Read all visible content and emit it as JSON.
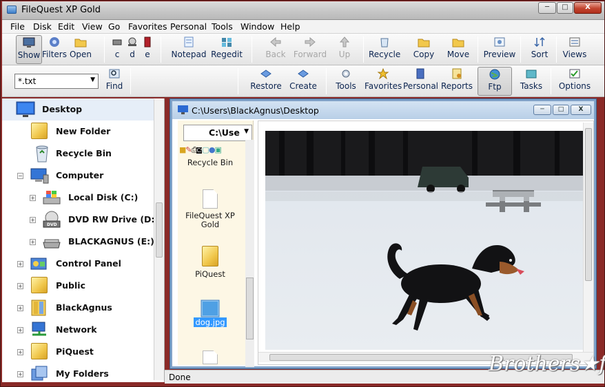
{
  "window": {
    "title": "FileQuest XP Gold"
  },
  "menu": [
    "File",
    "Disk",
    "Edit",
    "View",
    "Go",
    "Favorites",
    "Personal",
    "Tools",
    "Window",
    "Help"
  ],
  "toolbar1": {
    "show": "Show",
    "filters": "Filters",
    "open": "Open",
    "c": "c",
    "d": "d",
    "e": "e",
    "notepad": "Notepad",
    "regedit": "Regedit",
    "back": "Back",
    "forward": "Forward",
    "up": "Up",
    "recycle": "Recycle",
    "copy": "Copy",
    "move": "Move",
    "preview": "Preview",
    "sort": "Sort",
    "views": "Views"
  },
  "toolbar2": {
    "filter_value": "*.txt",
    "find": "Find",
    "restore": "Restore",
    "create": "Create",
    "tools": "Tools",
    "favorites": "Favorites",
    "personal": "Personal",
    "reports": "Reports",
    "ftp": "Ftp",
    "tasks": "Tasks",
    "options": "Options"
  },
  "tree": [
    {
      "label": "Desktop",
      "icon": "desktop-icon"
    },
    {
      "label": "New Folder",
      "icon": "folder-icon"
    },
    {
      "label": "Recycle Bin",
      "icon": "recycle-bin-icon"
    },
    {
      "label": "Computer",
      "icon": "computer-icon"
    },
    {
      "label": "Local Disk (C:)",
      "icon": "hard-disk-icon"
    },
    {
      "label": "DVD RW Drive (D:)",
      "icon": "dvd-drive-icon"
    },
    {
      "label": "BLACKAGNUS (E:)",
      "icon": "removable-drive-icon"
    },
    {
      "label": "Control Panel",
      "icon": "control-panel-icon"
    },
    {
      "label": "Public",
      "icon": "folder-icon"
    },
    {
      "label": "BlackAgnus",
      "icon": "user-folder-icon"
    },
    {
      "label": "Network",
      "icon": "network-icon"
    },
    {
      "label": "PiQuest",
      "icon": "folder-icon"
    },
    {
      "label": "My Folders",
      "icon": "folders-icon"
    }
  ],
  "child_window": {
    "title": "C:\\Users\\BlackAgnus\\Desktop",
    "drive_value": "C:\\Use",
    "files": [
      {
        "label": "Recycle Bin",
        "icon": "recycle-bin-icon"
      },
      {
        "label": "FileQuest XP Gold",
        "icon": "document-icon"
      },
      {
        "label": "PiQuest",
        "icon": "folder-icon"
      },
      {
        "label": "dog.jpg",
        "icon": "image-file-icon",
        "selected": true
      }
    ]
  },
  "status": {
    "text": "Done"
  },
  "watermark": "Brothersoft",
  "colors": {
    "window_frame": "#8a2a28",
    "child_frame": "#7fa2c9",
    "selection": "#3399ff"
  }
}
